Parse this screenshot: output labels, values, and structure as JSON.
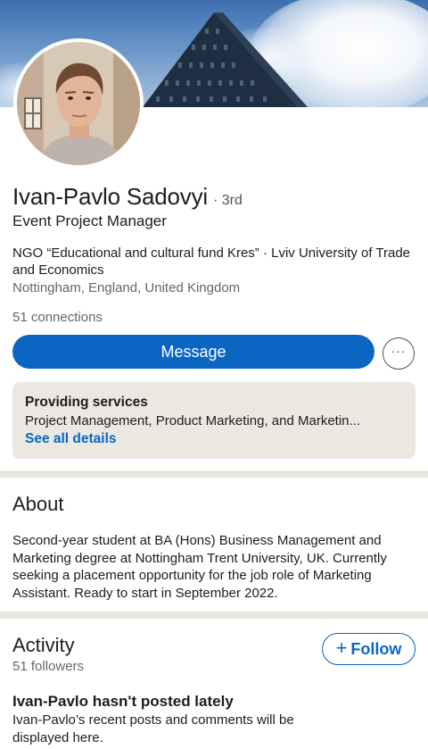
{
  "profile": {
    "name": "Ivan-Pavlo Sadovyi",
    "degree": "· 3rd",
    "headline": "Event Project Manager",
    "organization": "NGO “Educational and cultural fund Kres” · Lviv University of Trade and Economics",
    "location": "Nottingham, England, United Kingdom",
    "connections": "51 connections"
  },
  "actions": {
    "message_label": "Message",
    "more_icon": "more-horizontal-icon",
    "more_label": "···"
  },
  "services": {
    "title": "Providing services",
    "list": "Project Management, Product Marketing, and Marketin...",
    "link": "See all details"
  },
  "about": {
    "title": "About",
    "text": "Second-year student at BA (Hons) Business Management and Marketing degree at Nottingham Trent University, UK. Currently seeking a placement opportunity for the job role of Marketing Assistant. Ready to start in September 2022."
  },
  "activity": {
    "title": "Activity",
    "followers": "51 followers",
    "follow_plus": "+",
    "follow_label": "Follow",
    "empty_title": "Ivan-Pavlo hasn't posted lately",
    "empty_text": "Ivan-Pavlo’s recent posts and comments will be displayed here."
  },
  "colors": {
    "accent": "#0a66c2",
    "divider": "#e9e6df",
    "services_bg": "#ebe8e2"
  }
}
